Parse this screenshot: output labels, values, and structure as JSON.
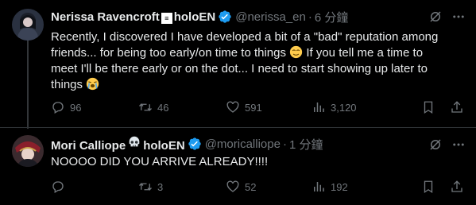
{
  "tweets": [
    {
      "name_prefix": "Nerissa Ravencroft",
      "name_badge": "≡",
      "name_suffix": "holoEN",
      "handle": "@nerissa_en",
      "separator": "·",
      "time": "6 分鐘",
      "text_line1": "Recently, I discovered I have developed a bit of a \"bad\" reputation among",
      "text_line2a": "friends... for being too early/on time to things ",
      "text_line2b": " If you tell me a time to",
      "text_line3": "meet I'll be there early or on the dot... I need to start showing up later to",
      "text_line4": "things ",
      "replies": "96",
      "retweets": "46",
      "likes": "591",
      "views": "3,120"
    },
    {
      "name_prefix": "Mori Calliope",
      "name_suffix": "holoEN",
      "handle": "@moricalliope",
      "separator": "·",
      "time": "1 分鐘",
      "text": "NOOOO DID YOU ARRIVE ALREADY!!!!",
      "replies": "",
      "retweets": "3",
      "likes": "52",
      "views": "192"
    }
  ],
  "colors": {
    "background": "#000000",
    "text": "#e7e9ea",
    "muted": "#71767b",
    "verified": "#1d9bf0",
    "divider": "#2f3336"
  },
  "icons": [
    "grok-icon",
    "more-icon",
    "reply-icon",
    "retweet-icon",
    "like-icon",
    "views-icon",
    "bookmark-icon",
    "share-icon",
    "verified-badge-icon"
  ]
}
